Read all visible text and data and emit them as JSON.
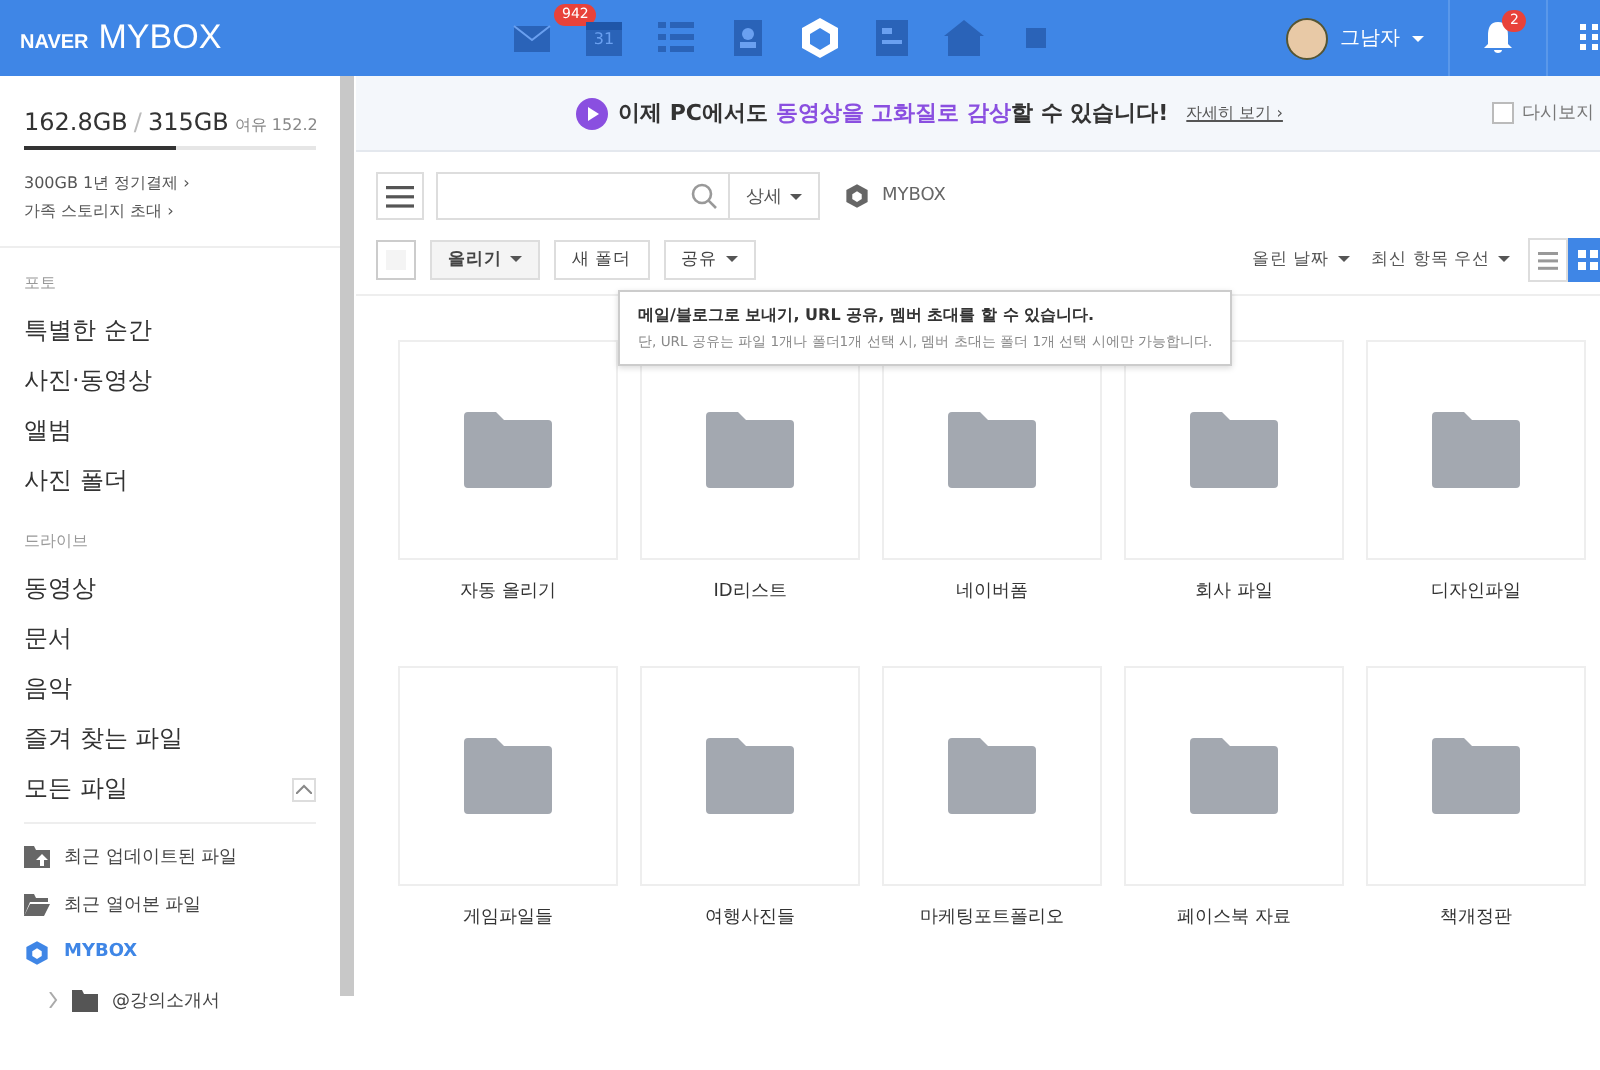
{
  "header": {
    "brand": "NAVER",
    "product": "MYBOX",
    "apps": [
      {
        "kind": "mail",
        "badge": "942",
        "selected": false
      },
      {
        "kind": "calendar",
        "label": "31",
        "selected": false
      },
      {
        "kind": "list",
        "selected": false
      },
      {
        "kind": "contact",
        "selected": false
      },
      {
        "kind": "mybox",
        "selected": true
      },
      {
        "kind": "memo",
        "selected": false
      },
      {
        "kind": "home",
        "selected": false
      },
      {
        "kind": "square",
        "selected": false
      }
    ],
    "user": {
      "name": "그남자"
    },
    "notifications": {
      "badge": "2"
    }
  },
  "sidebar": {
    "storage": {
      "used": "162.8GB",
      "separator": "/",
      "total": "315GB",
      "free": "여유 152.2",
      "level": 0.52
    },
    "links": [
      "300GB 1년 정기결제 ›",
      "가족 스토리지 초대 ›"
    ],
    "sections": [
      {
        "title": "포토",
        "items": [
          {
            "label": "특별한 순간"
          },
          {
            "label": "사진·동영상"
          },
          {
            "label": "앨범"
          },
          {
            "label": "사진 폴더"
          }
        ]
      },
      {
        "title": "드라이브",
        "items": [
          {
            "label": "동영상"
          },
          {
            "label": "문서"
          },
          {
            "label": "음악"
          },
          {
            "label": "즐겨 찾는 파일"
          },
          {
            "label": "모든 파일",
            "expanded": true
          }
        ]
      }
    ],
    "tree": [
      {
        "kind": "recent-updated",
        "label": "최근 업데이트된 파일",
        "selected": false
      },
      {
        "kind": "recent-opened",
        "label": "최근 열어본 파일",
        "selected": false
      },
      {
        "kind": "mybox",
        "label": "MYBOX",
        "selected": true,
        "children": [
          {
            "label": "@강의소개서",
            "expanded": false
          }
        ]
      }
    ]
  },
  "banner": {
    "parts": [
      {
        "text": "이제 PC에서도 ",
        "highlight": false
      },
      {
        "text": "동영상을 고화질로 감상",
        "highlight": true
      },
      {
        "text": "할 수 있습니다!",
        "highlight": false
      }
    ],
    "link": "자세히 보기 ›",
    "dismiss": {
      "label": "다시보지",
      "checked": false
    }
  },
  "toolbar": {
    "select_all": {
      "checked": false
    },
    "detail": "상세",
    "location": "MYBOX",
    "buttons": [
      {
        "label": "올리기",
        "dropdown": true
      },
      {
        "label": "새 폴더",
        "dropdown": false
      },
      {
        "label": "공유",
        "dropdown": true
      }
    ],
    "sort": [
      "올린 날짜",
      "최신 항목 우선"
    ],
    "views": [
      {
        "kind": "list",
        "selected": false
      },
      {
        "kind": "grid",
        "selected": true
      }
    ]
  },
  "tooltip": {
    "title": "메일/블로그로 보내기, URL 공유, 멤버 초대를 할 수 있습니다.",
    "body": "단, URL 공유는 파일 1개나 폴더1개 선택 시, 멤버 초대는 폴더 1개 선택 시에만 가능합니다."
  },
  "folders": [
    "자동 올리기",
    "ID리스트",
    "네이버폼",
    "회사 파일",
    "디자인파일",
    "게임파일들",
    "여행사진들",
    "마케팅포트폴리오",
    "페이스북 자료",
    "책개정판"
  ]
}
